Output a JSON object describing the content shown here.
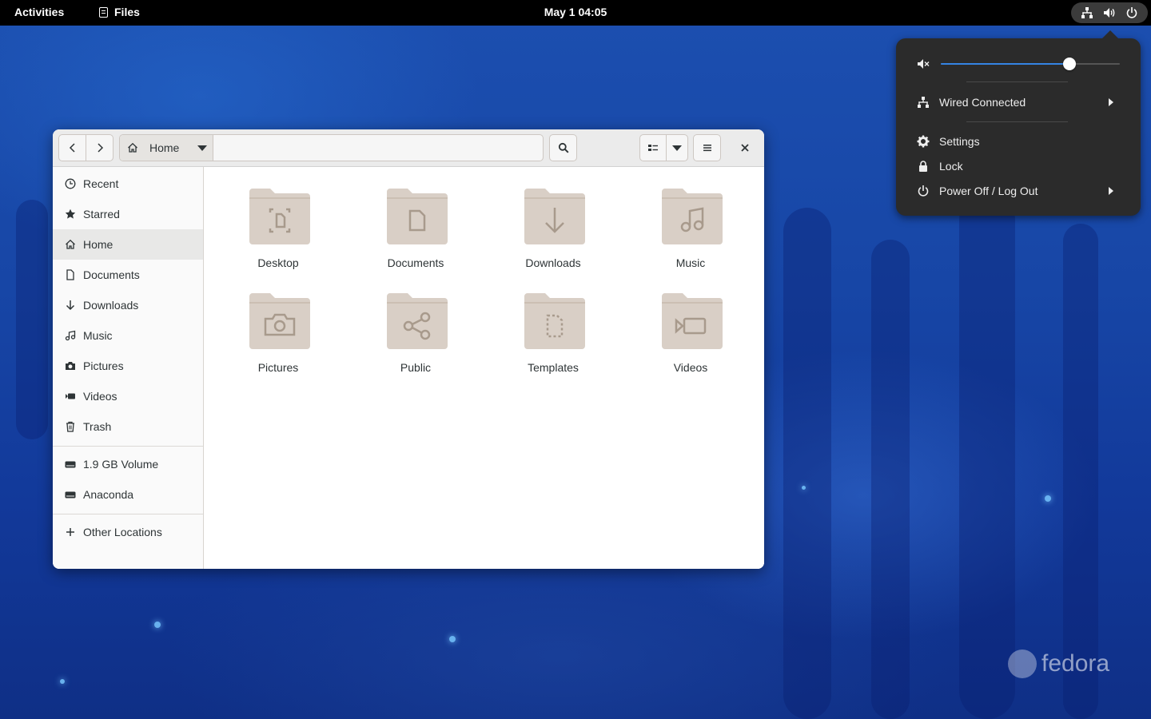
{
  "topbar": {
    "activities": "Activities",
    "app_name": "Files",
    "clock": "May 1  04:05"
  },
  "system_menu": {
    "volume_level": 0.72,
    "network_label": "Wired Connected",
    "settings_label": "Settings",
    "lock_label": "Lock",
    "power_label": "Power Off / Log Out"
  },
  "window": {
    "path_label": "Home",
    "sidebar": {
      "recent": "Recent",
      "starred": "Starred",
      "home": "Home",
      "documents": "Documents",
      "downloads": "Downloads",
      "music": "Music",
      "pictures": "Pictures",
      "videos": "Videos",
      "trash": "Trash",
      "volume": "1.9 GB Volume",
      "anaconda": "Anaconda",
      "other": "Other Locations"
    },
    "folders": [
      {
        "name": "Desktop",
        "icon": "desktop-folder-icon"
      },
      {
        "name": "Documents",
        "icon": "documents-folder-icon"
      },
      {
        "name": "Downloads",
        "icon": "downloads-folder-icon"
      },
      {
        "name": "Music",
        "icon": "music-folder-icon"
      },
      {
        "name": "Pictures",
        "icon": "pictures-folder-icon"
      },
      {
        "name": "Public",
        "icon": "public-folder-icon"
      },
      {
        "name": "Templates",
        "icon": "templates-folder-icon"
      },
      {
        "name": "Videos",
        "icon": "videos-folder-icon"
      }
    ]
  },
  "wallpaper": {
    "brand": "fedora"
  },
  "colors": {
    "accent": "#3584e4",
    "folder": "#d9cfc6",
    "folder_glyph": "#a89a8c"
  }
}
